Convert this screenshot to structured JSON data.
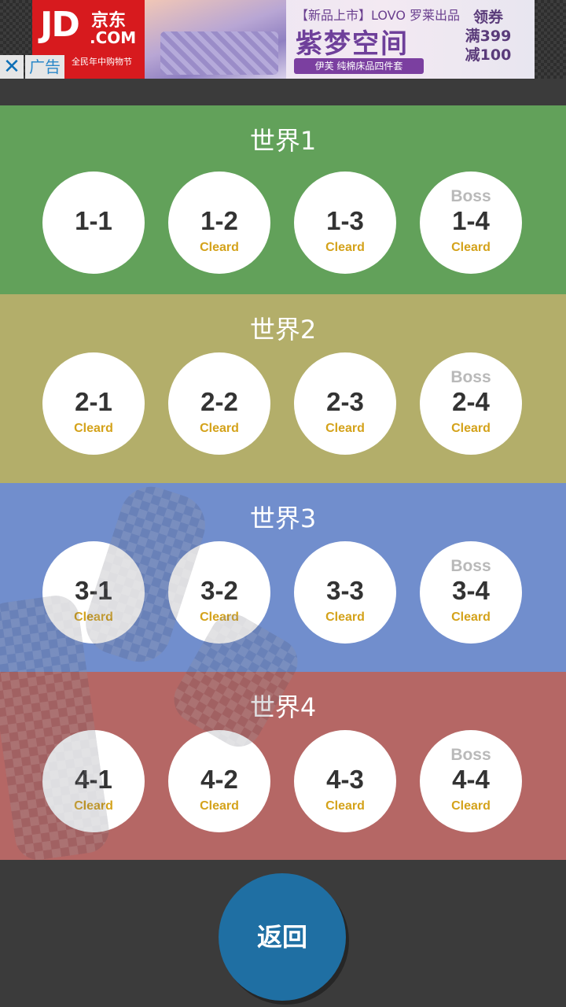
{
  "ad": {
    "logo_jd": "JD",
    "logo_cn": "京东",
    "logo_com": ".COM",
    "logo_slogan": "全民年中购物节",
    "title_line1": "【新品上市】LOVO 罗莱出品",
    "title_line2": "紫梦空间",
    "subtitle": "伊芙 纯棉床品四件套",
    "coupon_line1": "领券",
    "coupon_line2": "满399",
    "coupon_line3": "减100",
    "close_glyph": "✕",
    "tag": "广告"
  },
  "worlds": [
    {
      "title": "世界1",
      "color": "#62a15a",
      "stages": [
        {
          "label": "1-1",
          "cleared": "",
          "boss": ""
        },
        {
          "label": "1-2",
          "cleared": "Cleard",
          "boss": ""
        },
        {
          "label": "1-3",
          "cleared": "Cleard",
          "boss": ""
        },
        {
          "label": "1-4",
          "cleared": "Cleard",
          "boss": "Boss"
        }
      ]
    },
    {
      "title": "世界2",
      "color": "#b3ae6a",
      "stages": [
        {
          "label": "2-1",
          "cleared": "Cleard",
          "boss": ""
        },
        {
          "label": "2-2",
          "cleared": "Cleard",
          "boss": ""
        },
        {
          "label": "2-3",
          "cleared": "Cleard",
          "boss": ""
        },
        {
          "label": "2-4",
          "cleared": "Cleard",
          "boss": "Boss"
        }
      ]
    },
    {
      "title": "世界3",
      "color": "#718ecd",
      "stages": [
        {
          "label": "3-1",
          "cleared": "Cleard",
          "boss": ""
        },
        {
          "label": "3-2",
          "cleared": "Cleard",
          "boss": ""
        },
        {
          "label": "3-3",
          "cleared": "Cleard",
          "boss": ""
        },
        {
          "label": "3-4",
          "cleared": "Cleard",
          "boss": "Boss"
        }
      ]
    },
    {
      "title": "世界4",
      "color": "#b56765",
      "stages": [
        {
          "label": "4-1",
          "cleared": "Cleard",
          "boss": ""
        },
        {
          "label": "4-2",
          "cleared": "Cleard",
          "boss": ""
        },
        {
          "label": "4-3",
          "cleared": "Cleard",
          "boss": ""
        },
        {
          "label": "4-4",
          "cleared": "Cleard",
          "boss": "Boss"
        }
      ]
    }
  ],
  "back_button": "返回"
}
